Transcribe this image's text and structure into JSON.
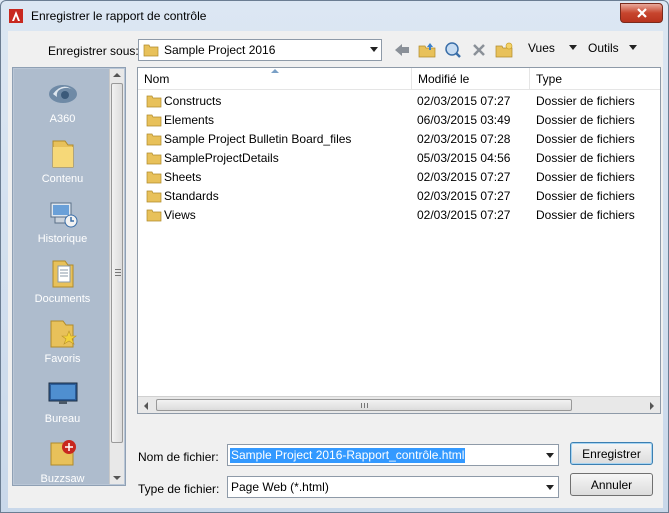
{
  "window": {
    "title": "Enregistrer le rapport de contrôle"
  },
  "toolbar": {
    "save_in_label": "Enregistrer sous:",
    "current_folder": "Sample Project 2016",
    "views_label": "Vues",
    "tools_label": "Outils"
  },
  "places": [
    {
      "label": "A360",
      "icon": "a360-icon"
    },
    {
      "label": "Contenu",
      "icon": "folder-icon"
    },
    {
      "label": "Historique",
      "icon": "history-icon"
    },
    {
      "label": "Documents",
      "icon": "documents-icon"
    },
    {
      "label": "Favoris",
      "icon": "favorites-icon"
    },
    {
      "label": "Bureau",
      "icon": "desktop-icon"
    },
    {
      "label": "Buzzsaw",
      "icon": "buzzsaw-icon"
    }
  ],
  "filelist": {
    "columns": [
      "Nom",
      "Modifié le",
      "Type"
    ],
    "rows": [
      {
        "name": "Constructs",
        "modified": "02/03/2015 07:27",
        "type": "Dossier de fichiers"
      },
      {
        "name": "Elements",
        "modified": "06/03/2015 03:49",
        "type": "Dossier de fichiers"
      },
      {
        "name": "Sample Project Bulletin Board_files",
        "modified": "02/03/2015 07:28",
        "type": "Dossier de fichiers"
      },
      {
        "name": "SampleProjectDetails",
        "modified": "05/03/2015 04:56",
        "type": "Dossier de fichiers"
      },
      {
        "name": "Sheets",
        "modified": "02/03/2015 07:27",
        "type": "Dossier de fichiers"
      },
      {
        "name": "Standards",
        "modified": "02/03/2015 07:27",
        "type": "Dossier de fichiers"
      },
      {
        "name": "Views",
        "modified": "02/03/2015 07:27",
        "type": "Dossier de fichiers"
      }
    ]
  },
  "form": {
    "filename_label": "Nom de fichier:",
    "filename_value": "Sample Project 2016-Rapport_contrôle.html",
    "filetype_label": "Type de fichier:",
    "filetype_value": "Page Web (*.html)",
    "save_button_label": "Enregistrer",
    "cancel_button_label": "Annuler"
  },
  "colors": {
    "accent": "#3399ff",
    "folder": "#e8c15a",
    "close": "#c7452e",
    "sidebar": "#aebccd"
  }
}
